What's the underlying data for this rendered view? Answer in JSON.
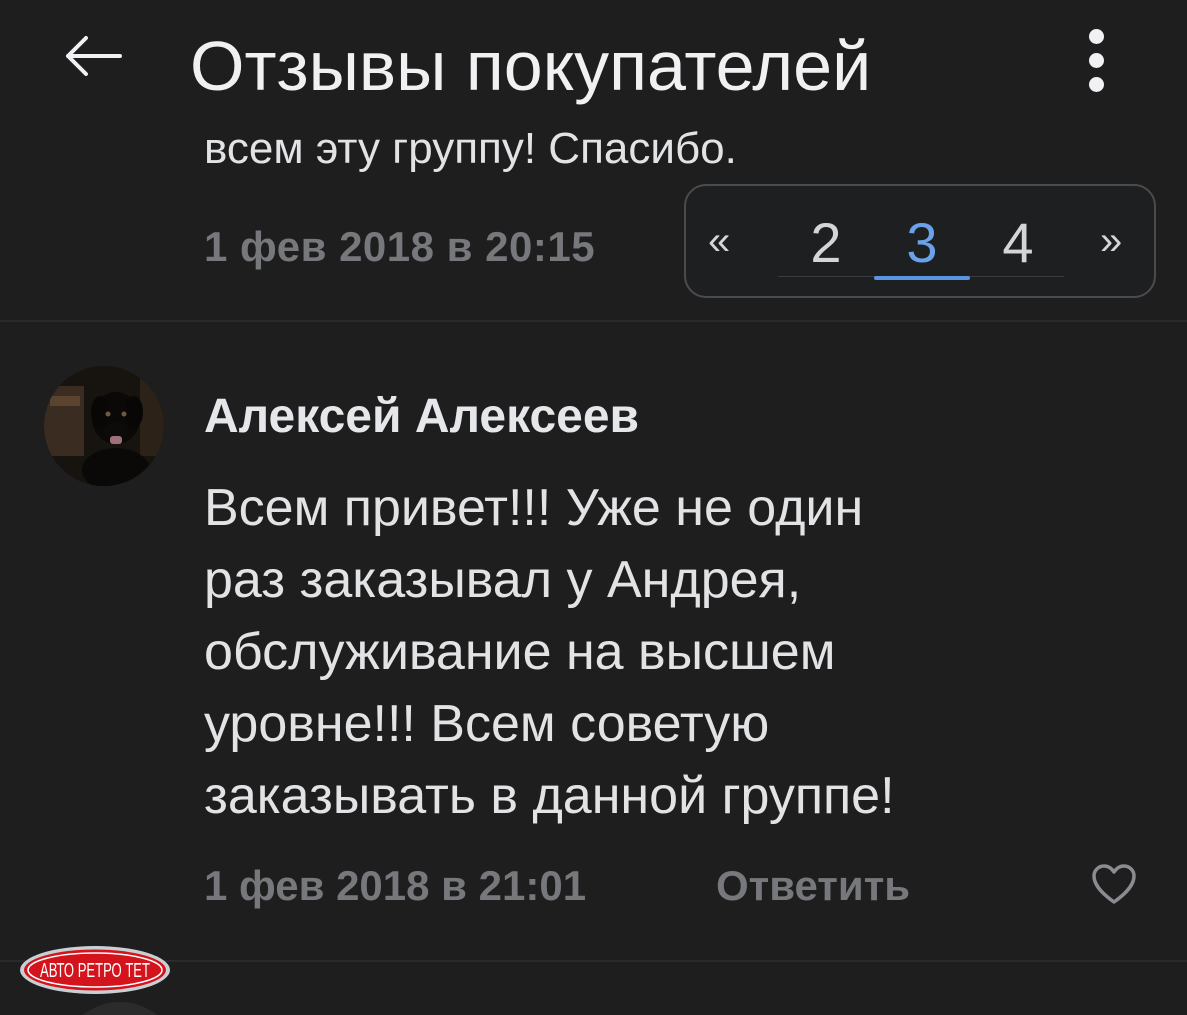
{
  "header": {
    "title": "Отзывы покупателей"
  },
  "previous_comment": {
    "text_fragment": "всем эту группу! Спасибо.",
    "date": "1 фев 2018 в 20:15"
  },
  "pagination": {
    "prev_label": "«",
    "next_label": "»",
    "pages": [
      "2",
      "3",
      "4"
    ],
    "active_page": "3"
  },
  "comment": {
    "author": "Алексей Алексеев",
    "text_lines": [
      "Всем привет!!! Уже не один",
      "раз заказывал у Андрея,",
      "обслуживание на высшем",
      "уровне!!! Всем советую",
      "заказывать в данной группе!"
    ],
    "date": "1 фев 2018 в 21:01",
    "reply_label": "Ответить"
  },
  "watermark": {
    "text": "АВТО РЕТРО ТЕТ"
  },
  "colors": {
    "background": "#1e1e1f",
    "accent": "#5b94e0",
    "muted_text": "#76787c"
  }
}
